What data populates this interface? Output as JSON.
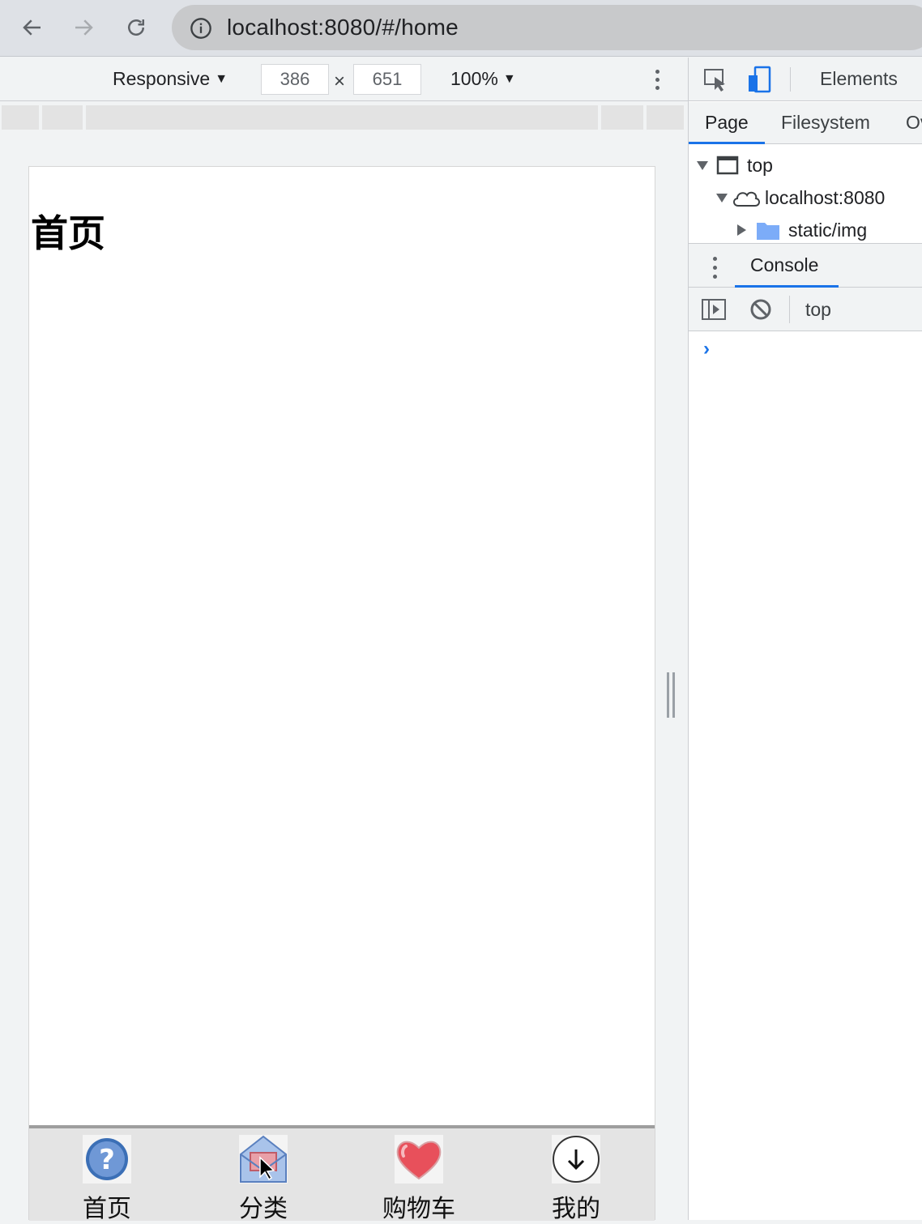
{
  "browser": {
    "url": "localhost:8080/#/home"
  },
  "device_toolbar": {
    "device": "Responsive",
    "width": "386",
    "height": "651",
    "times": "×",
    "zoom": "100%"
  },
  "page": {
    "title": "首页",
    "tabbar": [
      {
        "label": "首页",
        "icon": "help-circle-icon"
      },
      {
        "label": "分类",
        "icon": "mail-envelope-icon"
      },
      {
        "label": "购物车",
        "icon": "heart-icon"
      },
      {
        "label": "我的",
        "icon": "download-circle-icon"
      }
    ]
  },
  "devtools": {
    "main_tab": "Elements",
    "sources_tabs": [
      "Page",
      "Filesystem",
      "Ov"
    ],
    "tree": {
      "frame": "top",
      "origin": "localhost:8080",
      "folder": "static/img"
    },
    "drawer_tab": "Console",
    "context": "top",
    "prompt": "›"
  },
  "colors": {
    "accent": "#1a73e8",
    "heart": "#e8505b",
    "help_blue": "#3b6fb6"
  }
}
